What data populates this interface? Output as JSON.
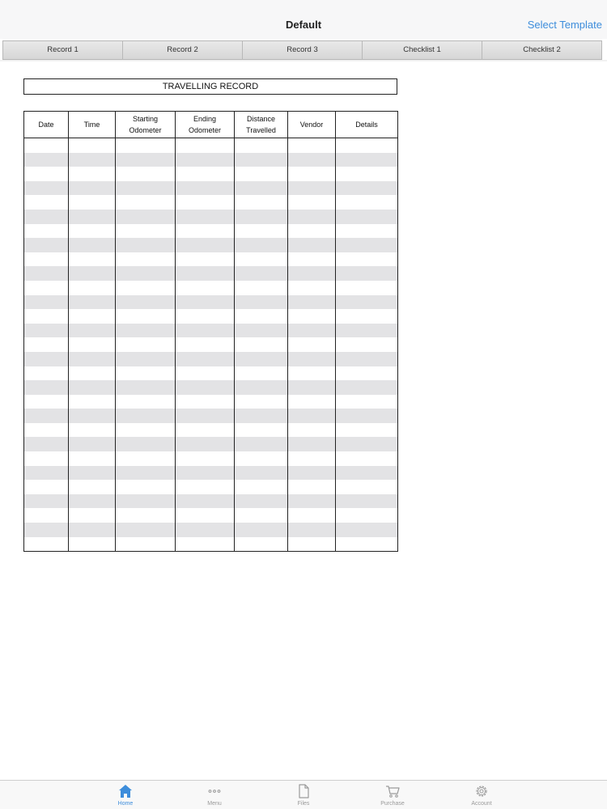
{
  "nav": {
    "title": "Default",
    "action": "Select Template"
  },
  "tabs": [
    {
      "label": "Record 1"
    },
    {
      "label": "Record 2"
    },
    {
      "label": "Record 3"
    },
    {
      "label": "Checklist 1"
    },
    {
      "label": "Checklist 2"
    }
  ],
  "document": {
    "title": "TRAVELLING RECORD",
    "columns": [
      "Date",
      "Time",
      "Starting\nOdometer",
      "Ending\nOdometer",
      "Distance\nTravelled",
      "Vendor",
      "Details"
    ]
  },
  "tabbar": {
    "items": [
      {
        "label": "Home",
        "icon": "home-icon"
      },
      {
        "label": "Menu",
        "icon": "more-dots-icon"
      },
      {
        "label": "Files",
        "icon": "file-icon"
      },
      {
        "label": "Purchase",
        "icon": "cart-icon"
      },
      {
        "label": "Account",
        "icon": "gear-icon"
      }
    ]
  },
  "colors": {
    "accent": "#3d8ddb",
    "row_stripe": "#e3e3e5",
    "inactive_icon": "#9a9a9a"
  }
}
